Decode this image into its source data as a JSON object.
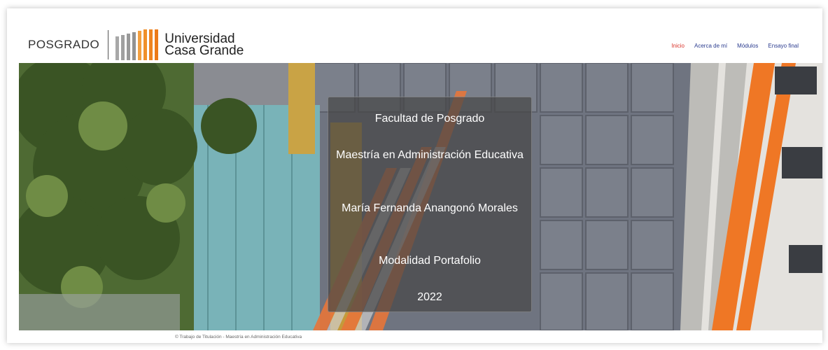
{
  "header": {
    "posgrado_label": "POSGRADO",
    "logo_line1": "Universidad",
    "logo_line2": "Casa Grande"
  },
  "nav": {
    "items": [
      {
        "label": "Inicio",
        "active": true
      },
      {
        "label": "Acerca de mí",
        "active": false
      },
      {
        "label": "Módulos",
        "active": false
      },
      {
        "label": "Ensayo final",
        "active": false
      }
    ]
  },
  "hero": {
    "line1": "Facultad de Posgrado",
    "line2": "Maestría en Administración Educativa",
    "line3": "María Fernanda Anangonó Morales",
    "line4": "Modalidad Portafolio",
    "line5": "2022"
  },
  "footer": {
    "text": "© Trabajo de Titulación - Maestría en Administración Educativa"
  },
  "colors": {
    "nav_link": "#2b3c8f",
    "nav_active": "#d9342b",
    "logo_orange": "#f08a24",
    "logo_gray": "#9a9a9a",
    "stripe_orange": "#f07a22"
  }
}
